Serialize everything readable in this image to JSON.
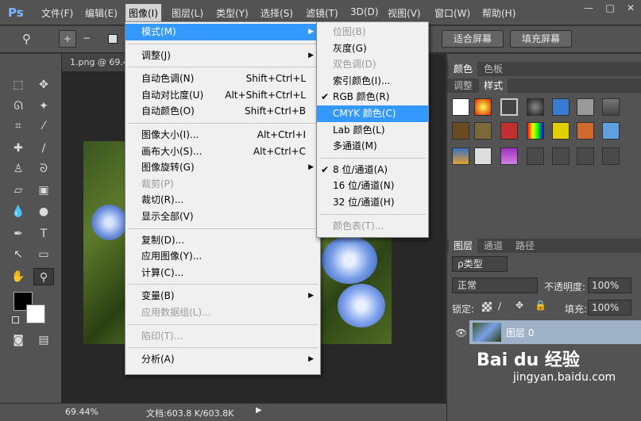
{
  "app": {
    "logo": "Ps"
  },
  "menubar": {
    "items": [
      "文件(F)",
      "编辑(E)",
      "图像(I)",
      "图层(L)",
      "类型(Y)",
      "选择(S)",
      "滤镜(T)",
      "3D(D)",
      "视图(V)",
      "窗口(W)",
      "帮助(H)"
    ],
    "window_controls": [
      "—",
      "□",
      "✕"
    ]
  },
  "options": {
    "fit_screen": "适合屏幕",
    "fill_screen": "填充屏幕"
  },
  "document": {
    "tab": "1.png @ 69.4"
  },
  "status": {
    "zoom": "69.44%",
    "doc": "文档:603.8 K/603.8K"
  },
  "image_menu": {
    "groups": [
      [
        {
          "label": "模式(M)",
          "submenu": true,
          "highlight": true
        }
      ],
      [
        {
          "label": "调整(J)",
          "submenu": true
        }
      ],
      [
        {
          "label": "自动色调(N)",
          "shortcut": "Shift+Ctrl+L"
        },
        {
          "label": "自动对比度(U)",
          "shortcut": "Alt+Shift+Ctrl+L"
        },
        {
          "label": "自动颜色(O)",
          "shortcut": "Shift+Ctrl+B"
        }
      ],
      [
        {
          "label": "图像大小(I)...",
          "shortcut": "Alt+Ctrl+I"
        },
        {
          "label": "画布大小(S)...",
          "shortcut": "Alt+Ctrl+C"
        },
        {
          "label": "图像旋转(G)",
          "submenu": true
        },
        {
          "label": "裁剪(P)",
          "disabled": true
        },
        {
          "label": "裁切(R)..."
        },
        {
          "label": "显示全部(V)"
        }
      ],
      [
        {
          "label": "复制(D)..."
        },
        {
          "label": "应用图像(Y)..."
        },
        {
          "label": "计算(C)..."
        }
      ],
      [
        {
          "label": "变量(B)",
          "submenu": true
        },
        {
          "label": "应用数据组(L)...",
          "disabled": true
        }
      ],
      [
        {
          "label": "陷印(T)...",
          "disabled": true
        }
      ],
      [
        {
          "label": "分析(A)",
          "submenu": true
        }
      ]
    ]
  },
  "mode_submenu": {
    "groups": [
      [
        {
          "label": "位图(B)",
          "disabled": true
        },
        {
          "label": "灰度(G)"
        },
        {
          "label": "双色调(D)",
          "disabled": true
        },
        {
          "label": "索引颜色(I)..."
        },
        {
          "label": "RGB 颜色(R)",
          "checked": true
        },
        {
          "label": "CMYK 颜色(C)",
          "highlight": true
        },
        {
          "label": "Lab 颜色(L)"
        },
        {
          "label": "多通道(M)"
        }
      ],
      [
        {
          "label": "8 位/通道(A)",
          "checked": true
        },
        {
          "label": "16 位/通道(N)"
        },
        {
          "label": "32 位/通道(H)"
        }
      ],
      [
        {
          "label": "颜色表(T)...",
          "disabled": true
        }
      ]
    ]
  },
  "panels": {
    "color_tabs": [
      "颜色",
      "色板"
    ],
    "adjust_tabs": [
      "调整",
      "样式"
    ],
    "layer_tabs": [
      "图层",
      "通道",
      "路径"
    ],
    "kind": "ρ类型",
    "blend_mode": "正常",
    "opacity_label": "不透明度:",
    "opacity": "100%",
    "lock_label": "锁定:",
    "fill_label": "填充:",
    "fill": "100%",
    "layer_name": "图层 0"
  },
  "colors": {
    "highlight": "#3399ff",
    "panel": "#535353",
    "menu_bg": "#f0f0f0"
  },
  "watermark": {
    "text": "Bai du 经验",
    "url": "jingyan.baidu.com"
  }
}
